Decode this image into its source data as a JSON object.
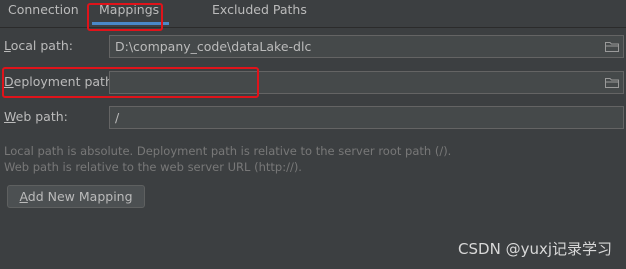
{
  "tabs": [
    {
      "label": "Connection"
    },
    {
      "label": "Mappings",
      "selected": true
    },
    {
      "label": "Excluded Paths"
    }
  ],
  "local_path": {
    "label_mnemonic": "L",
    "label_rest": "ocal path:",
    "value": "D:\\company_code\\dataLake-dlc",
    "icon": "folder-icon"
  },
  "deployment_path": {
    "label_mnemonic": "D",
    "label_rest": "eployment path:",
    "value": "",
    "icon": "folder-icon"
  },
  "web_path": {
    "label_mnemonic": "W",
    "label_rest": "eb path:",
    "value": "/"
  },
  "hints": [
    "Local path is absolute. Deployment path is relative to the server root path (/).",
    "Web path is relative to the web server URL (http://)."
  ],
  "add_mapping_button": {
    "mnemonic": "A",
    "rest": "dd New Mapping"
  },
  "watermark": "CSDN @yuxj记录学习",
  "colors": {
    "background": "#3c3f41",
    "field_background": "#45494a",
    "selected_tab_underline": "#4a88c7",
    "highlight_box": "#e0131a"
  }
}
